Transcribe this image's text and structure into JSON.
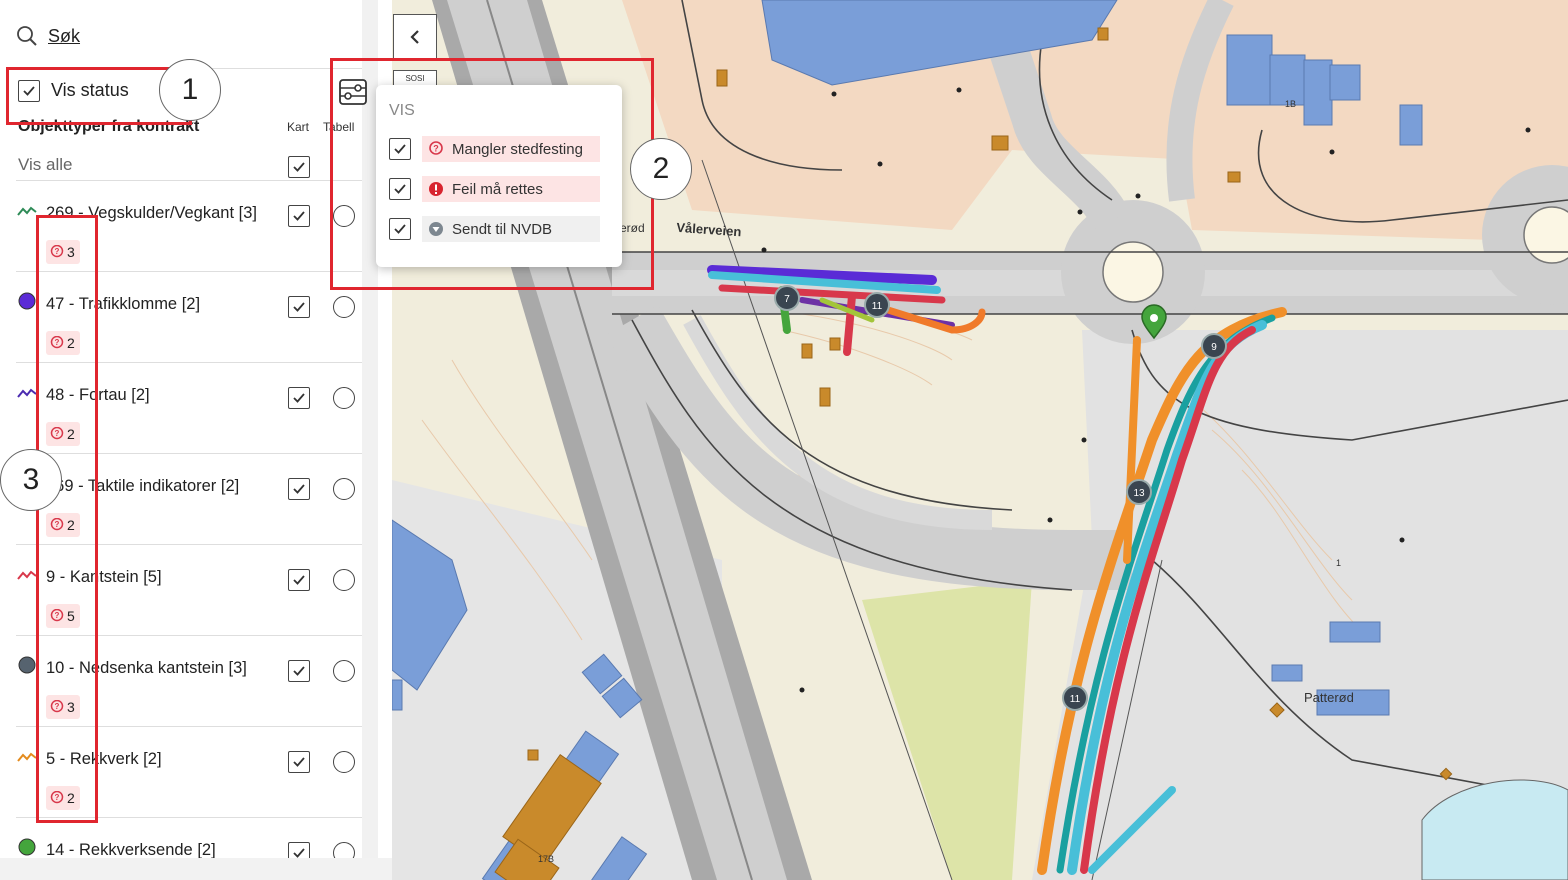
{
  "search": {
    "label": "Søk"
  },
  "vis_status": {
    "label": "Vis status",
    "checked": true
  },
  "object_types": {
    "title": "Objekttyper fra kontrakt",
    "col_map": "Kart",
    "col_table": "Tabell",
    "vis_alle": "Vis alle",
    "items": [
      {
        "label": "269 - Vegskulder/Vegkant [3]",
        "badge": "3",
        "icon": "line-green-icon",
        "color": "#2e8b57"
      },
      {
        "label": "47 - Trafikklomme [2]",
        "badge": "2",
        "icon": "dot-purple-icon",
        "color": "#5b2bd6"
      },
      {
        "label": "48 - Fortau [2]",
        "badge": "2",
        "icon": "line-purple-icon",
        "color": "#4b2bb0"
      },
      {
        "label": "269 - Taktile indikatorer [2]",
        "badge": "2",
        "icon": "line-teal-icon",
        "color": "#1aa0a0"
      },
      {
        "label": "9 - Kantstein [5]",
        "badge": "5",
        "icon": "line-red-icon",
        "color": "#d8384b"
      },
      {
        "label": "10 - Nedsenka kantstein [3]",
        "badge": "3",
        "icon": "dot-gray-icon",
        "color": "#56636f"
      },
      {
        "label": "5 - Rekkverk [2]",
        "badge": "2",
        "icon": "line-orange-icon",
        "color": "#e48b1d"
      },
      {
        "label": "14 - Rekkverksende [2]",
        "badge": "",
        "icon": "dot-green-icon",
        "color": "#44a53c"
      }
    ]
  },
  "popup": {
    "header": "VIS",
    "items": [
      {
        "label": "Mangler stedfesting",
        "icon": "question-marker-icon",
        "bg": "#fde4e4"
      },
      {
        "label": "Feil må rettes",
        "icon": "exclamation-icon",
        "bg": "#fde4e4"
      },
      {
        "label": "Sendt til NVDB",
        "icon": "nvdb-sent-icon",
        "bg": "#f0f0f0"
      }
    ]
  },
  "map": {
    "road_label": "Vålerveien",
    "road_label_cut": "erød",
    "place_label": "Patterød",
    "building_labels": [
      "1B",
      "17B",
      "1"
    ],
    "sosi_label": "SOSI",
    "clusters": [
      "7",
      "11",
      "9",
      "13",
      "11"
    ]
  },
  "annotations": [
    "1",
    "2",
    "3"
  ],
  "colors": {
    "annotation_red": "#e0262f",
    "badge_bg": "#fde4e4"
  }
}
